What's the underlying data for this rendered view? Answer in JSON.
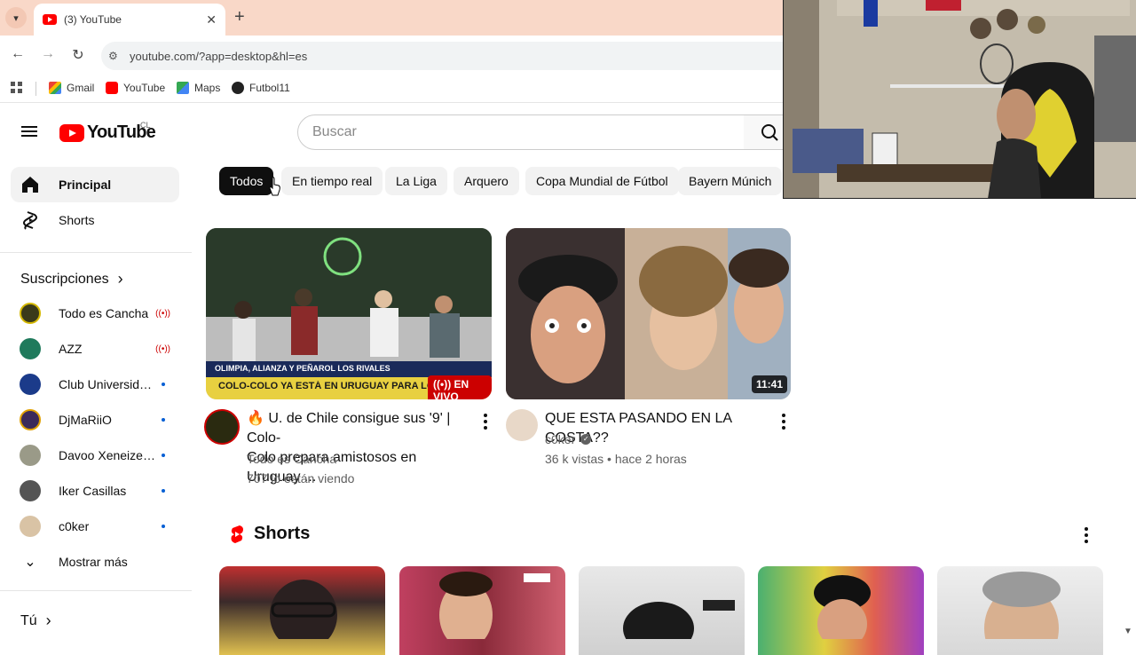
{
  "browser": {
    "tab_title": "(3) YouTube",
    "tab_close": "✕",
    "new_tab": "+",
    "url": "youtube.com/?app=desktop&hl=es",
    "bookmarks": [
      "Gmail",
      "YouTube",
      "Maps",
      "Futbol11"
    ]
  },
  "header": {
    "logo_text": "YouTube",
    "country": "CL",
    "search_placeholder": "Buscar"
  },
  "sidebar": {
    "main": [
      {
        "label": "Principal",
        "icon": "home-icon"
      },
      {
        "label": "Shorts",
        "icon": "shorts-icon"
      }
    ],
    "subscriptions_heading": "Suscripciones",
    "subscriptions": [
      {
        "name": "Todo es Cancha",
        "status": "live",
        "color": "#3a3a1a"
      },
      {
        "name": "AZZ",
        "status": "live",
        "color": "#1f7a5c"
      },
      {
        "name": "Club Universidad…",
        "status": "new",
        "color": "#1b3b8a"
      },
      {
        "name": "DjMaRiiO",
        "status": "new",
        "color": "#3b2a5a"
      },
      {
        "name": "Davoo Xeneize P…",
        "status": "new",
        "color": "#9a9a88"
      },
      {
        "name": "Iker Casillas",
        "status": "new",
        "color": "#555555"
      },
      {
        "name": "c0ker",
        "status": "new",
        "color": "#d9c3a5"
      }
    ],
    "show_more": "Mostrar más",
    "you_heading": "Tú"
  },
  "chips": [
    "Todos",
    "En tiempo real",
    "La Liga",
    "Arquero",
    "Copa Mundial de Fútbol",
    "Bayern Múnich"
  ],
  "videos": [
    {
      "title_line1": "🔥 U. de Chile consigue sus '9' | Colo-",
      "title_line2": "Colo prepara amistosos en Uruguay ...",
      "channel": "Todo es Cancha",
      "meta": "707 lo están viendo",
      "badge": "EN VIVO",
      "thumb_caption_top": "OLIMPIA, ALIANZA Y PEÑAROL LOS RIVALES",
      "thumb_caption_bottom": "COLO-COLO YA ESTÁ EN URUGUAY PARA LOS AMISTOSOS"
    },
    {
      "title_line1": "QUE ESTA PASANDO EN LA COSTA??",
      "title_line2": "",
      "channel": "c0ker",
      "meta": "36 k vistas • hace 2 horas",
      "badge": "11:41"
    }
  ],
  "shorts_heading": "Shorts",
  "colors": {
    "tabbar": "#f9d8c8",
    "brand_red": "#ff0000",
    "live_red": "#cc0000",
    "chip_bg": "#f2f2f2"
  }
}
